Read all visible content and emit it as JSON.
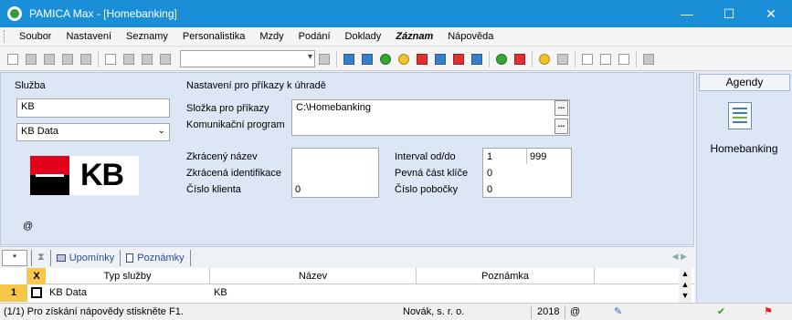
{
  "window": {
    "title": "PAMICA Max - [Homebanking]"
  },
  "menu": {
    "items": [
      "Soubor",
      "Nastavení",
      "Seznamy",
      "Personalistika",
      "Mzdy",
      "Podání",
      "Doklady",
      "Záznam",
      "Nápověda"
    ]
  },
  "sluzba": {
    "heading": "Služba",
    "code": "KB",
    "select_value": "KB Data",
    "logo_text": "KB",
    "at_sign": "@"
  },
  "nastaveni": {
    "heading": "Nastavení pro příkazy k úhradě",
    "slozka_label": "Složka pro příkazy",
    "slozka_value": "C:\\Homebanking",
    "komunikacni_label": "Komunikační program",
    "komunikacni_value": "",
    "zkraceny_nazev_label": "Zkrácený název",
    "zkracena_ident_label": "Zkrácená identifikace",
    "cislo_klienta_label": "Číslo klienta",
    "cislo_klienta_value": "0",
    "interval_label": "Interval od/do",
    "interval_od": "1",
    "interval_do": "999",
    "pevna_cast_label": "Pevná část klíče",
    "pevna_cast_value": "0",
    "cislo_pobocky_label": "Číslo pobočky",
    "cislo_pobocky_value": "0",
    "dots": "..."
  },
  "agenda": {
    "header": "Agendy",
    "item_label": "Homebanking"
  },
  "tabs": {
    "first": "*",
    "upominky": "Upomínky",
    "poznamky": "Poznámky"
  },
  "grid": {
    "x_header": "X",
    "columns": [
      "Typ služby",
      "Název",
      "Poznámka"
    ],
    "rows": [
      {
        "num": "1",
        "typ": "KB Data",
        "nazev": "KB",
        "poznamka": ""
      }
    ]
  },
  "status": {
    "hint": "(1/1) Pro získání nápovědy stiskněte F1.",
    "company": "Novák, s. r. o.",
    "year": "2018",
    "at": "@"
  }
}
